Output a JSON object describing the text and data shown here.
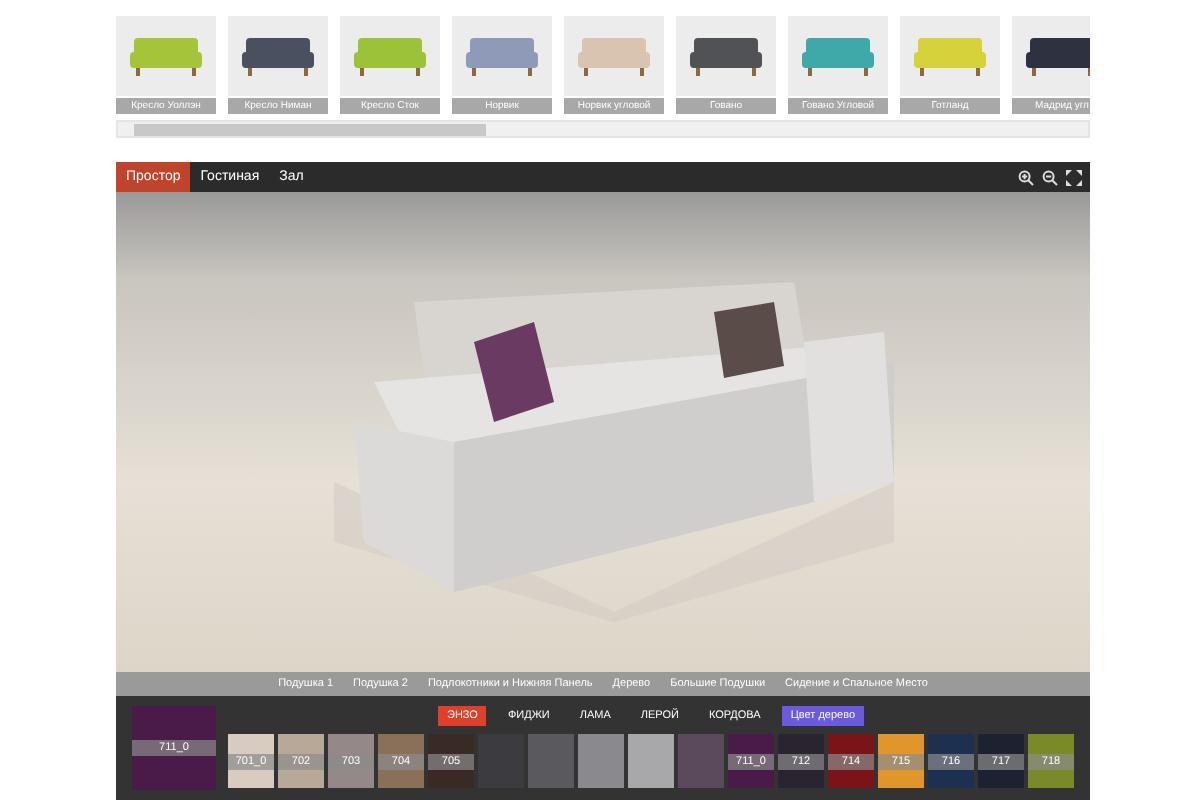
{
  "products": [
    {
      "label": "Кресло Уоллэн",
      "color": "#a6c43a",
      "selected": false
    },
    {
      "label": "Кресло Ниман",
      "color": "#4a5060",
      "selected": false
    },
    {
      "label": "Кресло Сток",
      "color": "#9cc23a",
      "selected": false
    },
    {
      "label": "Норвик",
      "color": "#8e9ab8",
      "selected": false
    },
    {
      "label": "Норвик угловой",
      "color": "#d8c4b0",
      "selected": false
    },
    {
      "label": "Говано",
      "color": "#505256",
      "selected": false
    },
    {
      "label": "Говано Угловой",
      "color": "#3fa8a8",
      "selected": false
    },
    {
      "label": "Готланд",
      "color": "#d6d23a",
      "selected": false
    },
    {
      "label": "Мадрид угл",
      "color": "#2e3240",
      "selected": false
    }
  ],
  "scene_tabs": [
    {
      "label": "Простор",
      "selected": true
    },
    {
      "label": "Гостиная",
      "selected": false
    },
    {
      "label": "Зал",
      "selected": false
    }
  ],
  "parts": [
    {
      "label": "Подушка 1"
    },
    {
      "label": "Подушка 2"
    },
    {
      "label": "Подлокотники и Нижняя Панель"
    },
    {
      "label": "Дерево"
    },
    {
      "label": "Большие Подушки"
    },
    {
      "label": "Сидение и Спальное Место"
    }
  ],
  "current_swatch": {
    "label": "711_0",
    "color": "#4a1a48"
  },
  "fabrics": [
    {
      "label": "ЭНЗО",
      "kind": "fabric",
      "selected": true
    },
    {
      "label": "ФИДЖИ",
      "kind": "fabric",
      "selected": false
    },
    {
      "label": "ЛАМА",
      "kind": "fabric",
      "selected": false
    },
    {
      "label": "ЛЕРОЙ",
      "kind": "fabric",
      "selected": false
    },
    {
      "label": "КОРДОВА",
      "kind": "fabric",
      "selected": false
    },
    {
      "label": "Цвет дерево",
      "kind": "wood",
      "selected": false
    }
  ],
  "swatches": [
    {
      "label": "701_0",
      "color": "#d8ccc0"
    },
    {
      "label": "702",
      "color": "#b8a898"
    },
    {
      "label": "703",
      "color": "#948888"
    },
    {
      "label": "704",
      "color": "#8a7058"
    },
    {
      "label": "705",
      "color": "#3a2a26"
    },
    {
      "color": "#3c3c40"
    },
    {
      "color": "#5a5a5e"
    },
    {
      "color": "#8a8a8e"
    },
    {
      "color": "#a8a8aa"
    },
    {
      "color": "#5a4a5c"
    },
    {
      "label": "711_0",
      "color": "#4a1a48"
    },
    {
      "label": "712",
      "color": "#2a2430"
    },
    {
      "label": "714",
      "color": "#7a1418"
    },
    {
      "label": "715",
      "color": "#e0962a"
    },
    {
      "label": "716",
      "color": "#1e3050"
    },
    {
      "label": "717",
      "color": "#1c2230"
    },
    {
      "label": "718",
      "color": "#7a8a28"
    }
  ]
}
